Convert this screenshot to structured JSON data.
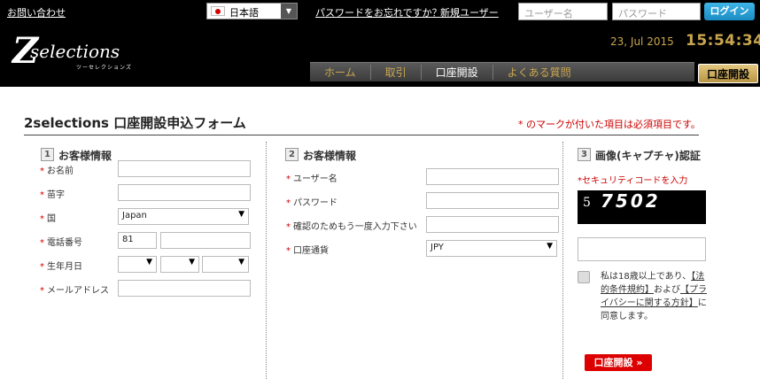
{
  "header": {
    "contact_link": "お問い合わせ",
    "language": "日本語",
    "forgot_password": "パスワードをお忘れですか？",
    "new_user": "新規ユーザー",
    "username_placeholder": "ユーザー名",
    "password_placeholder": "パスワード",
    "login_button": "ログイン",
    "logo_text": "selections",
    "logo_letter": "Z",
    "logo_sub": "ツーセレクションズ",
    "date": "23, Jul 2015",
    "time": "15:54:34"
  },
  "nav": {
    "items": [
      {
        "label": "ホーム"
      },
      {
        "label": "取引"
      },
      {
        "label": "口座開設"
      },
      {
        "label": "よくある質問"
      }
    ],
    "cta": "口座開設"
  },
  "form": {
    "title": "2selections 口座開設申込フォーム",
    "required_note": "* のマークが付いた項目は必須項目です。",
    "section1": {
      "num": "1",
      "title": "お客様情報",
      "name_label": "お名前",
      "surname_label": "苗字",
      "country_label": "国",
      "country_value": "Japan",
      "phone_label": "電話番号",
      "phone_code": "81",
      "dob_label": "生年月日",
      "email_label": "メールアドレス"
    },
    "section2": {
      "num": "2",
      "title": "お客様情報",
      "username_label": "ユーザー名",
      "password_label": "パスワード",
      "confirm_label": "確認のためもう一度入力下さい",
      "currency_label": "口座通貨",
      "currency_value": "JPY"
    },
    "section3": {
      "num": "3",
      "title": "画像(キャプチャ)認証",
      "security_label": "*セキュリティコードを入力",
      "captcha_first": "5",
      "captcha_rest": "7502",
      "agree_pre": "私は18歳以上であり、",
      "terms_link": "【法的条件規約】",
      "agree_mid": "および",
      "privacy_link": "【プライバシーに関する方針】",
      "agree_post": "に同意します。",
      "submit": "口座開設 »"
    }
  },
  "colors": {
    "accent_gold": "#c9a64e",
    "required_red": "#cc0000",
    "login_blue": "#1a8cc4"
  }
}
